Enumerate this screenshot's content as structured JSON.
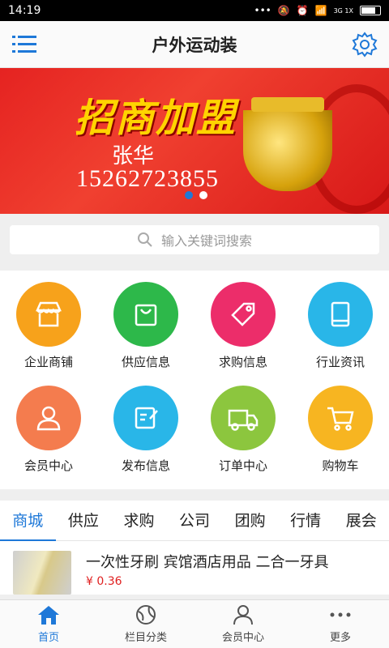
{
  "status": {
    "time": "14:19",
    "signal_text": "3G 1X"
  },
  "header": {
    "title": "户外运动装"
  },
  "banner": {
    "headline": "招商加盟",
    "name": "张华",
    "phone": "15262723855",
    "slides": 2,
    "active_slide": 0
  },
  "search": {
    "placeholder": "输入关键词搜索"
  },
  "grid": [
    {
      "label": "企业商铺",
      "icon": "shop-icon",
      "color": "#f7a21b"
    },
    {
      "label": "供应信息",
      "icon": "bag-icon",
      "color": "#2db84a"
    },
    {
      "label": "求购信息",
      "icon": "tag-icon",
      "color": "#ec2d6a"
    },
    {
      "label": "行业资讯",
      "icon": "tablet-icon",
      "color": "#29b6e8"
    },
    {
      "label": "会员中心",
      "icon": "user-icon",
      "color": "#f47c4e"
    },
    {
      "label": "发布信息",
      "icon": "edit-icon",
      "color": "#29b6e8"
    },
    {
      "label": "订单中心",
      "icon": "truck-icon",
      "color": "#8cc63e"
    },
    {
      "label": "购物车",
      "icon": "cart-icon",
      "color": "#f7b521"
    }
  ],
  "tabs": [
    "商城",
    "供应",
    "求购",
    "公司",
    "团购",
    "行情",
    "展会"
  ],
  "active_tab": 0,
  "product": {
    "title": "一次性牙刷 宾馆酒店用品 二合一牙具",
    "price": "¥ 0.36"
  },
  "bottom_nav": [
    {
      "label": "首页",
      "icon": "home-icon"
    },
    {
      "label": "栏目分类",
      "icon": "category-icon"
    },
    {
      "label": "会员中心",
      "icon": "member-icon"
    },
    {
      "label": "更多",
      "icon": "more-icon"
    }
  ],
  "colors": {
    "accent": "#1e78d8",
    "price": "#e02020"
  }
}
